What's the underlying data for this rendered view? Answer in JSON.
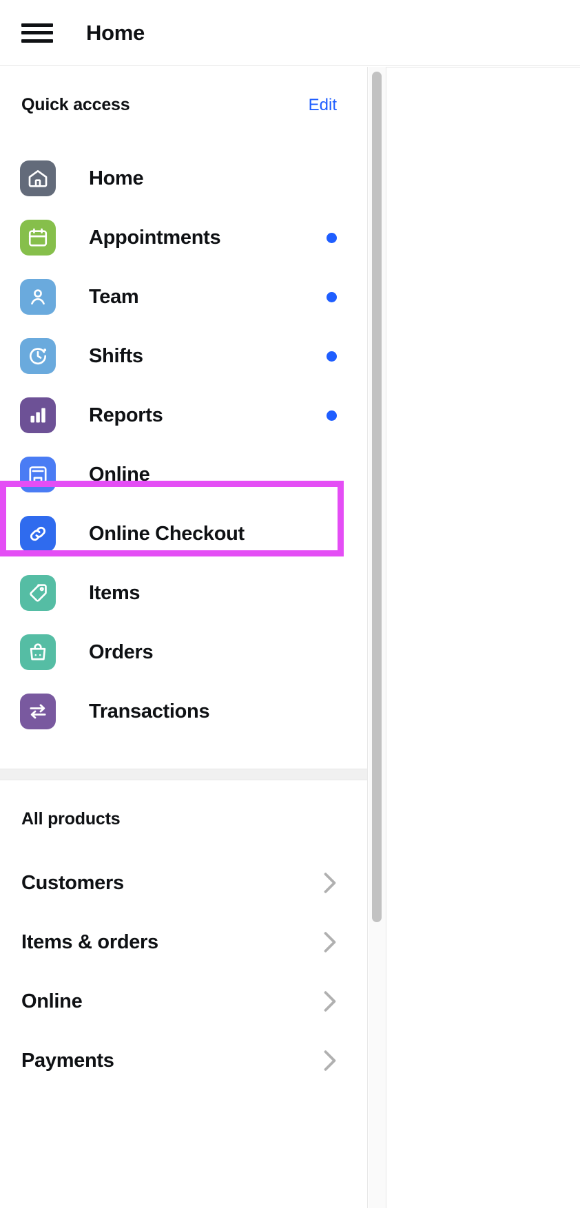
{
  "topbar": {
    "menu_icon": "hamburger-menu-icon",
    "title": "Home"
  },
  "quick_access": {
    "title": "Quick access",
    "edit_label": "Edit",
    "items": [
      {
        "label": "Home",
        "icon": "home-icon",
        "color": "#636b7a",
        "badge": false
      },
      {
        "label": "Appointments",
        "icon": "calendar-icon",
        "color": "#86bf4b",
        "badge": true
      },
      {
        "label": "Team",
        "icon": "person-icon",
        "color": "#6aaadd",
        "badge": true
      },
      {
        "label": "Shifts",
        "icon": "clock-icon",
        "color": "#6aaadd",
        "badge": true
      },
      {
        "label": "Reports",
        "icon": "bar-chart-icon",
        "color": "#6d5196",
        "badge": true
      },
      {
        "label": "Online",
        "icon": "storefront-icon",
        "color": "#4a7cf4",
        "badge": false
      },
      {
        "label": "Online Checkout",
        "icon": "link-icon",
        "color": "#2f6bee",
        "badge": false
      },
      {
        "label": "Items",
        "icon": "price-tag-icon",
        "color": "#55bda4",
        "badge": false
      },
      {
        "label": "Orders",
        "icon": "shopping-bag-icon",
        "color": "#55bda4",
        "badge": false
      },
      {
        "label": "Transactions",
        "icon": "transfer-arrows-icon",
        "color": "#79599f",
        "badge": false
      }
    ]
  },
  "all_products": {
    "title": "All products",
    "items": [
      {
        "label": "Customers",
        "chevron": "chevron-right-icon"
      },
      {
        "label": "Items & orders",
        "chevron": "chevron-right-icon"
      },
      {
        "label": "Online",
        "chevron": "chevron-right-icon"
      },
      {
        "label": "Payments",
        "chevron": "chevron-right-icon"
      }
    ]
  },
  "highlight": {
    "target": "Online",
    "color": "#e44ef5"
  },
  "colors": {
    "accent_blue": "#1f5eff",
    "text": "#0f1114",
    "divider": "#f0f0f0",
    "scrollbar": "#c2c2c2"
  }
}
